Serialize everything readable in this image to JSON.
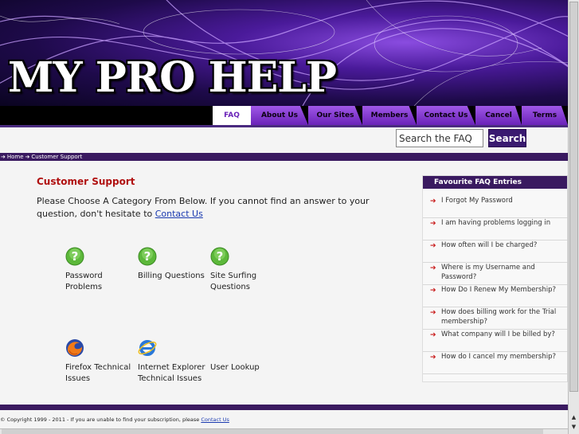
{
  "header": {
    "logo_text": "MY PRO HELP"
  },
  "nav": {
    "tabs": [
      {
        "label": "FAQ",
        "active": true
      },
      {
        "label": "About Us"
      },
      {
        "label": "Our Sites"
      },
      {
        "label": "Members"
      },
      {
        "label": "Contact Us"
      },
      {
        "label": "Cancel"
      },
      {
        "label": "Terms"
      }
    ]
  },
  "search": {
    "placeholder": "Search the FAQ",
    "button": "Search"
  },
  "breadcrumb": {
    "arrow": "➔",
    "home": "Home",
    "current": "Customer Support"
  },
  "main": {
    "title": "Customer Support",
    "intro": "Please Choose A Category From Below. If you cannot find an answer to your question, don't hesitate to ",
    "intro_link": "Contact Us",
    "categories": [
      {
        "label": "Password Problems",
        "icon": "question-icon"
      },
      {
        "label": "Billing Questions",
        "icon": "question-icon"
      },
      {
        "label": "Site Surfing Questions",
        "icon": "question-icon"
      },
      {
        "label": "Firefox Technical Issues",
        "icon": "firefox-icon"
      },
      {
        "label": "Internet Explorer Technical Issues",
        "icon": "internet-explorer-icon"
      },
      {
        "label": "User Lookup",
        "icon": "none"
      }
    ]
  },
  "sidebar": {
    "title": "Favourite FAQ Entries",
    "entries": [
      "I Forgot My Password",
      "I am having problems logging in",
      "How often will I be charged?",
      "Where is my Username and Password?",
      "How Do I Renew My Membership?",
      "How does billing work for the Trial membership?",
      "What company will I be billed by?",
      "How do I cancel my membership?"
    ]
  },
  "footer": {
    "text": "© Copyright 1999 - 2011 - If you are unable to find your subscription, please ",
    "link": "Contact Us"
  },
  "colors": {
    "accent": "#3a1a60",
    "tab": "#8a3ad8",
    "title": "#b01010",
    "link": "#1a3ab0"
  }
}
